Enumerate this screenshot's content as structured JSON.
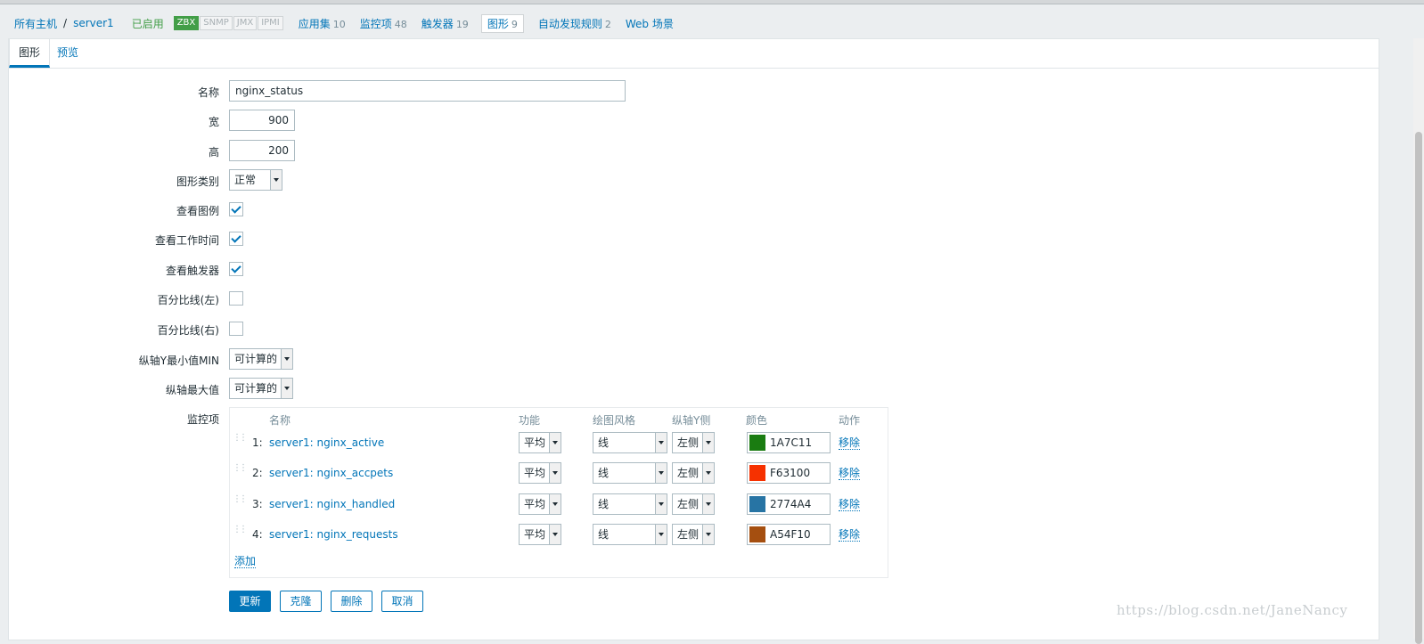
{
  "header": {
    "breadcrumb": [
      {
        "label": "所有主机"
      },
      {
        "label": "server1"
      }
    ],
    "breadcrumb_sep": "/",
    "status": "已启用",
    "availability": [
      "ZBX",
      "SNMP",
      "JMX",
      "IPMI"
    ],
    "nav": [
      {
        "label": "应用集",
        "count": "10"
      },
      {
        "label": "监控项",
        "count": "48"
      },
      {
        "label": "触发器",
        "count": "19"
      },
      {
        "label": "图形",
        "count": "9",
        "active": true
      },
      {
        "label": "自动发现规则",
        "count": "2"
      },
      {
        "label": "Web 场景",
        "count": ""
      }
    ]
  },
  "tabs": [
    "图形",
    "预览"
  ],
  "form": {
    "name_label": "名称",
    "name_value": "nginx_status",
    "width_label": "宽",
    "width_value": "900",
    "height_label": "高",
    "height_value": "200",
    "graph_type_label": "图形类别",
    "graph_type_value": "正常",
    "show_legend_label": "查看图例",
    "show_legend": true,
    "show_worktime_label": "查看工作时间",
    "show_worktime": true,
    "show_triggers_label": "查看触发器",
    "show_triggers": true,
    "percentile_left_label": "百分比线(左)",
    "percentile_left": false,
    "percentile_right_label": "百分比线(右)",
    "percentile_right": false,
    "ymin_label": "纵轴Y最小值MIN",
    "ymin_value": "可计算的",
    "ymax_label": "纵轴最大值",
    "ymax_value": "可计算的",
    "items_label": "监控项"
  },
  "items": {
    "headers": {
      "name": "名称",
      "function": "功能",
      "draw_style": "绘图风格",
      "y_side": "纵轴Y侧",
      "color": "颜色",
      "action": "动作"
    },
    "rows": [
      {
        "num": "1:",
        "name": "server1: nginx_active",
        "function": "平均",
        "draw_style": "线",
        "y_side": "左侧",
        "color": "1A7C11",
        "color_hex": "#1A7C11",
        "action": "移除"
      },
      {
        "num": "2:",
        "name": "server1: nginx_accpets",
        "function": "平均",
        "draw_style": "线",
        "y_side": "左侧",
        "color": "F63100",
        "color_hex": "#F63100",
        "action": "移除"
      },
      {
        "num": "3:",
        "name": "server1: nginx_handled",
        "function": "平均",
        "draw_style": "线",
        "y_side": "左侧",
        "color": "2774A4",
        "color_hex": "#2774A4",
        "action": "移除"
      },
      {
        "num": "4:",
        "name": "server1: nginx_requests",
        "function": "平均",
        "draw_style": "线",
        "y_side": "左侧",
        "color": "A54F10",
        "color_hex": "#A54F10",
        "action": "移除"
      }
    ],
    "add_label": "添加"
  },
  "buttons": {
    "update": "更新",
    "clone": "克隆",
    "delete": "删除",
    "cancel": "取消"
  },
  "watermark": "https://blog.csdn.net/JaneNancy"
}
